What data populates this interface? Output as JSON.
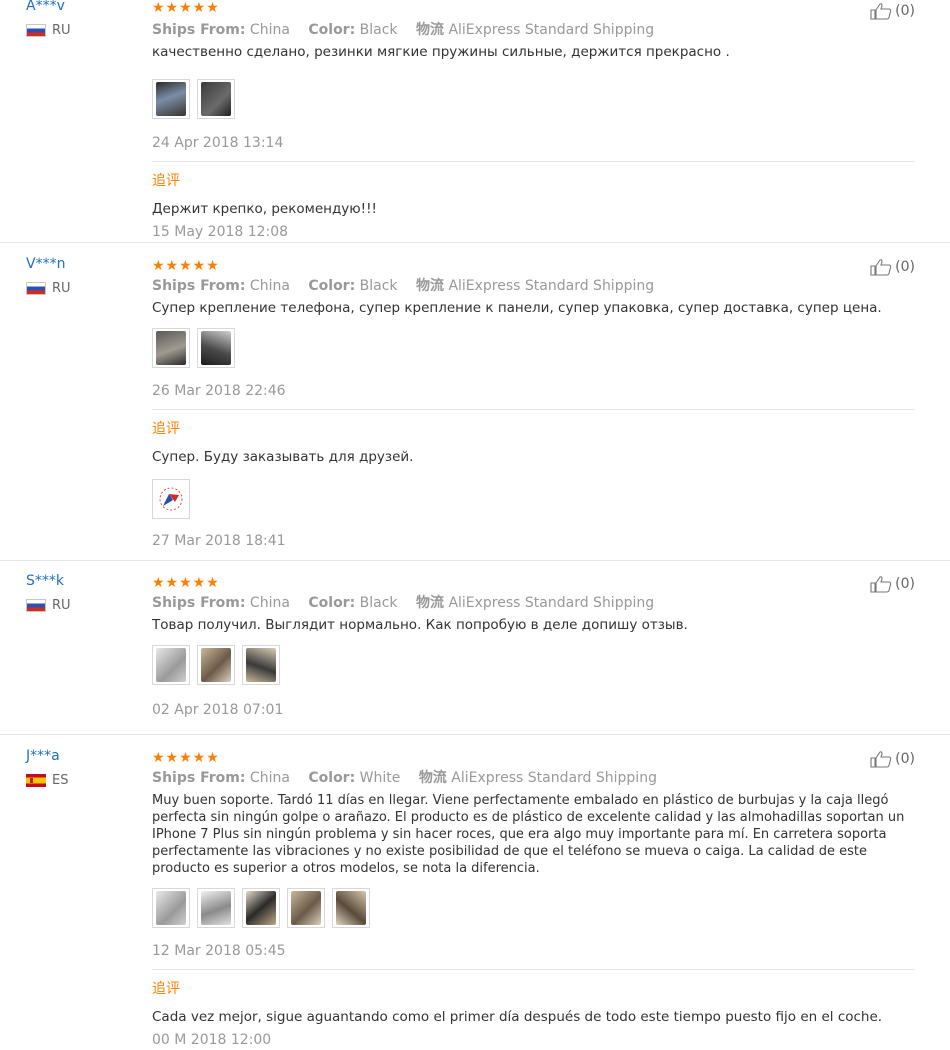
{
  "labels": {
    "ships_from": "Ships From:",
    "color": "Color:",
    "logistics": "物流",
    "additional_feedback": "追评"
  },
  "reviews": [
    {
      "user": "A***v",
      "country": "RU",
      "stars": "★★★★★",
      "ships_from": "China",
      "color": "Black",
      "shipping": "AliExpress Standard Shipping",
      "text": "качественно сделано, резинки мягкие пружины сильные, держится прекрасно .",
      "images": [
        "thumb-1",
        "thumb-2"
      ],
      "date": "24 Apr 2018 13:14",
      "helpful": "(0)",
      "followup": {
        "text": "Держит крепко, рекомендую!!!",
        "date": "15 May 2018 12:08"
      }
    },
    {
      "user": "V***n",
      "country": "RU",
      "stars": "★★★★★",
      "ships_from": "China",
      "color": "Black",
      "shipping": "AliExpress Standard Shipping",
      "text": "Супер крепление телефона, супер крепление к панели, супер упаковка, супер доставка, супер цена.",
      "date": "26 Mar 2018 22:46",
      "helpful": "(0)",
      "followup": {
        "text": "Супер. Буду заказывать для друзей.",
        "date": "27 Mar 2018 18:41"
      }
    },
    {
      "user": "S***k",
      "country": "RU",
      "stars": "★★★★★",
      "ships_from": "China",
      "color": "Black",
      "shipping": "AliExpress Standard Shipping",
      "text": "Товар получил. Выглядит нормально. Как попробую в деле допишу отзыв.",
      "date": "02 Apr 2018 07:01",
      "helpful": "(0)"
    },
    {
      "user": "J***a",
      "country": "ES",
      "stars": "★★★★★",
      "ships_from": "China",
      "color": "White",
      "shipping": "AliExpress Standard Shipping",
      "text": "Muy buen soporte. Tardó 11 días en llegar. Viene perfectamente embalado en plástico de burbujas y la caja llegó perfecta sin ningún golpe o arañazo. El producto es de plástico de excelente calidad y las almohadillas soportan un IPhone 7 Plus sin ningún problema y sin hacer roces, que era algo muy importante para mí. En carretera soporta perfectamente las vibraciones y no existe posibilidad de que el teléfono se mueva o caiga. La calidad de este producto es superior a otros modelos, se nota la diferencia.",
      "date": "12 Mar 2018 05:45",
      "helpful": "(0)",
      "followup": {
        "text": "Cada vez mejor, sigue aguantando como el primer día después de todo este tiempo puesto fijo en el coche.",
        "date": "00 M 2018 12:00"
      }
    }
  ]
}
